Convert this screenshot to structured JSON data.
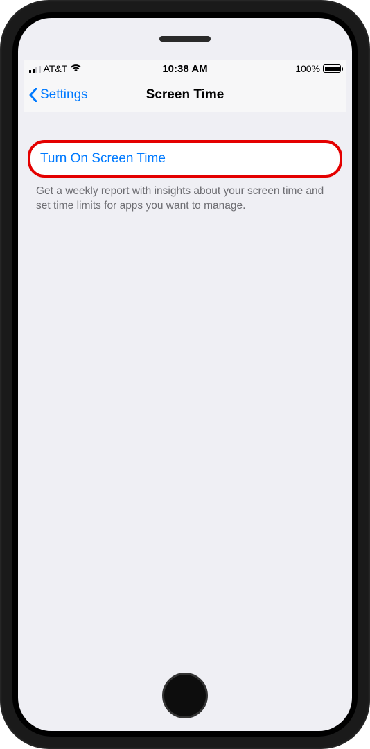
{
  "status_bar": {
    "carrier": "AT&T",
    "time": "10:38 AM",
    "battery_percent": "100%"
  },
  "nav": {
    "back_label": "Settings",
    "title": "Screen Time"
  },
  "main": {
    "action_label": "Turn On Screen Time",
    "description": "Get a weekly report with insights about your screen time and set time limits for apps you want to manage."
  }
}
